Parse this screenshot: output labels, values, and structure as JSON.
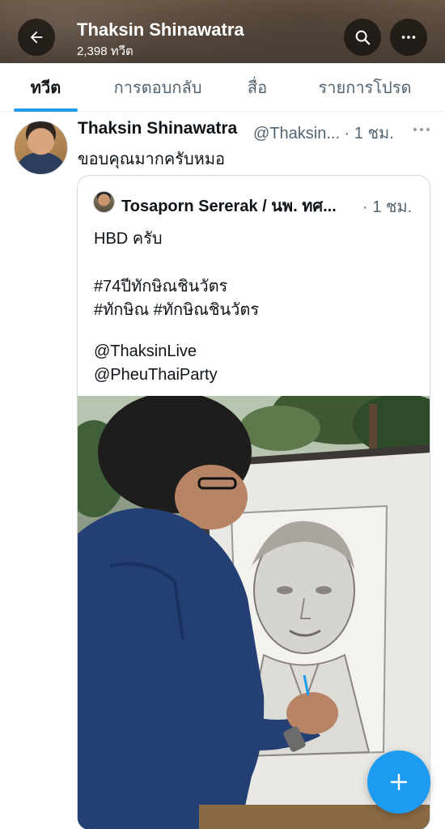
{
  "header": {
    "title": "Thaksin Shinawatra",
    "subtitle": "2,398 ทวีต",
    "back_icon": "arrow-left-icon",
    "search_icon": "search-icon",
    "more_icon": "more-horizontal-icon"
  },
  "tabs": [
    {
      "label": "ทวีต",
      "active": true
    },
    {
      "label": "การตอบกลับ",
      "active": false
    },
    {
      "label": "สื่อ",
      "active": false
    },
    {
      "label": "รายการโปรด",
      "active": false
    }
  ],
  "tweet": {
    "author_name": "Thaksin Shinawatra",
    "author_handle": "@Thaksin... · 1 ชม.",
    "text": "ขอบคุณมากครับหมอ",
    "more_icon": "more-horizontal-icon",
    "quote": {
      "author_name": "Tosaporn Sererak / นพ. ทศ...",
      "time": "· 1 ชม.",
      "lines": [
        "HBD ครับ",
        "#74ปีทักษิณชินวัตร",
        "#ทักษิณ #ทักษิณชินวัตร",
        "@ThaksinLive",
        "@PheuThaiParty"
      ]
    }
  },
  "compose": {
    "icon": "plus-icon"
  },
  "colors": {
    "accent": "#1d9bf0",
    "text_primary": "#0f1419",
    "text_secondary": "#536471",
    "border": "#cfd9de"
  }
}
